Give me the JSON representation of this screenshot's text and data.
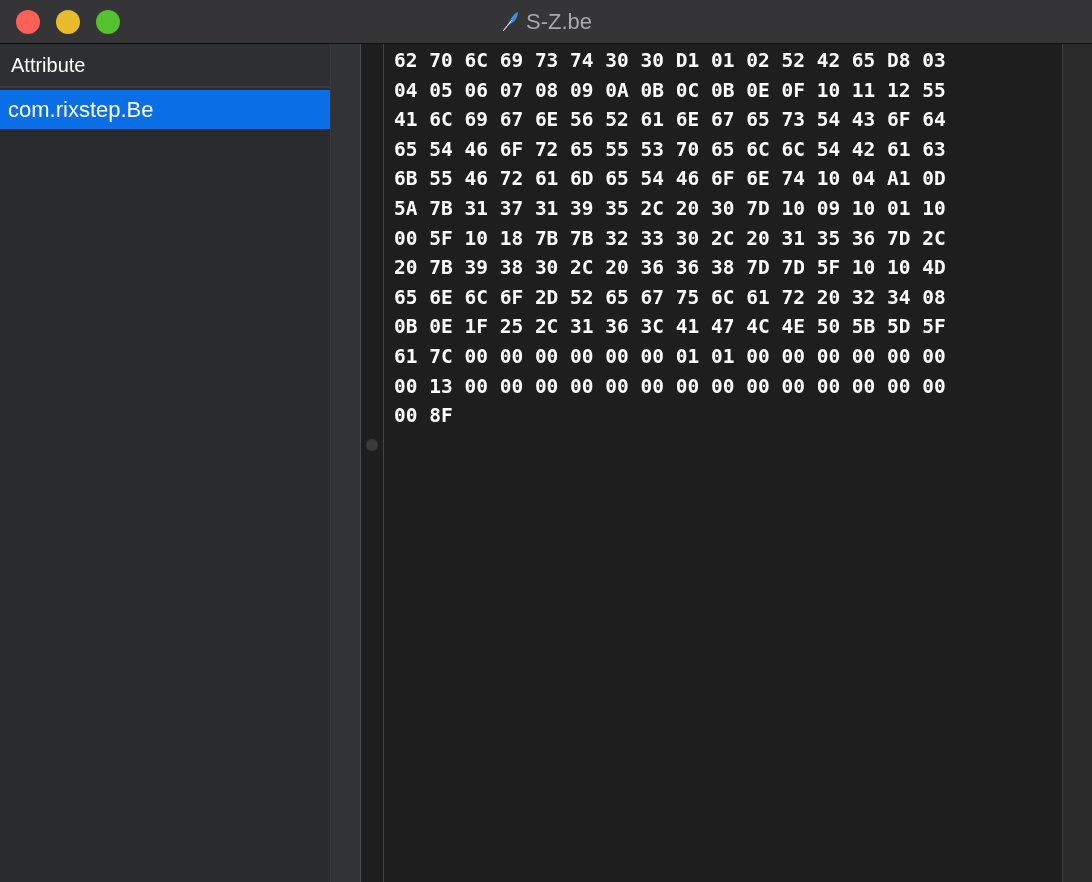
{
  "window": {
    "title": "S-Z.be"
  },
  "attribute_list": {
    "column_header": "Attribute",
    "items": [
      {
        "name": "com.rixstep.Be",
        "selected": true
      }
    ]
  },
  "hex_lines": [
    "62 70 6C 69 73 74 30 30 D1 01 02 52 42 65 D8 03",
    "04 05 06 07 08 09 0A 0B 0C 0B 0E 0F 10 11 12 55",
    "41 6C 69 67 6E 56 52 61 6E 67 65 73 54 43 6F 64",
    "65 54 46 6F 72 65 55 53 70 65 6C 6C 54 42 61 63",
    "6B 55 46 72 61 6D 65 54 46 6F 6E 74 10 04 A1 0D",
    "5A 7B 31 37 31 39 35 2C 20 30 7D 10 09 10 01 10",
    "00 5F 10 18 7B 7B 32 33 30 2C 20 31 35 36 7D 2C",
    "20 7B 39 38 30 2C 20 36 36 38 7D 7D 5F 10 10 4D",
    "65 6E 6C 6F 2D 52 65 67 75 6C 61 72 20 32 34 08",
    "0B 0E 1F 25 2C 31 36 3C 41 47 4C 4E 50 5B 5D 5F",
    "61 7C 00 00 00 00 00 00 01 01 00 00 00 00 00 00",
    "00 13 00 00 00 00 00 00 00 00 00 00 00 00 00 00",
    "00 8F"
  ]
}
